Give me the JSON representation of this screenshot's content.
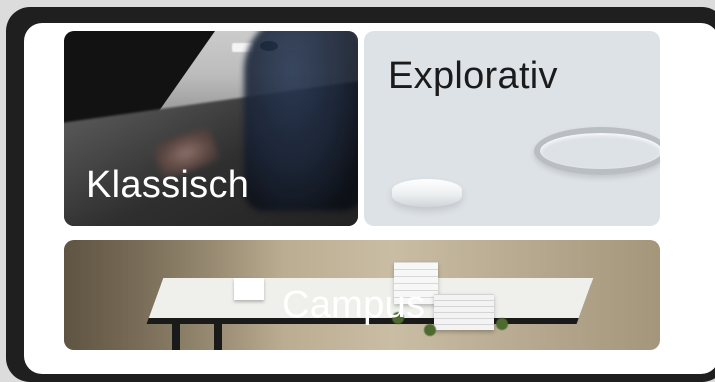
{
  "cards": {
    "klassisch": {
      "label": "Klassisch"
    },
    "explorativ": {
      "label": "Explorativ"
    },
    "campus": {
      "label": "Campus"
    }
  },
  "colors": {
    "device_frame": "#1f1f1f",
    "screen_bg": "#ffffff",
    "explorativ_bg": "#dde2e6",
    "klassisch_bg": "#121212",
    "label_light": "#ffffff",
    "label_dark": "#1b1b1b"
  }
}
